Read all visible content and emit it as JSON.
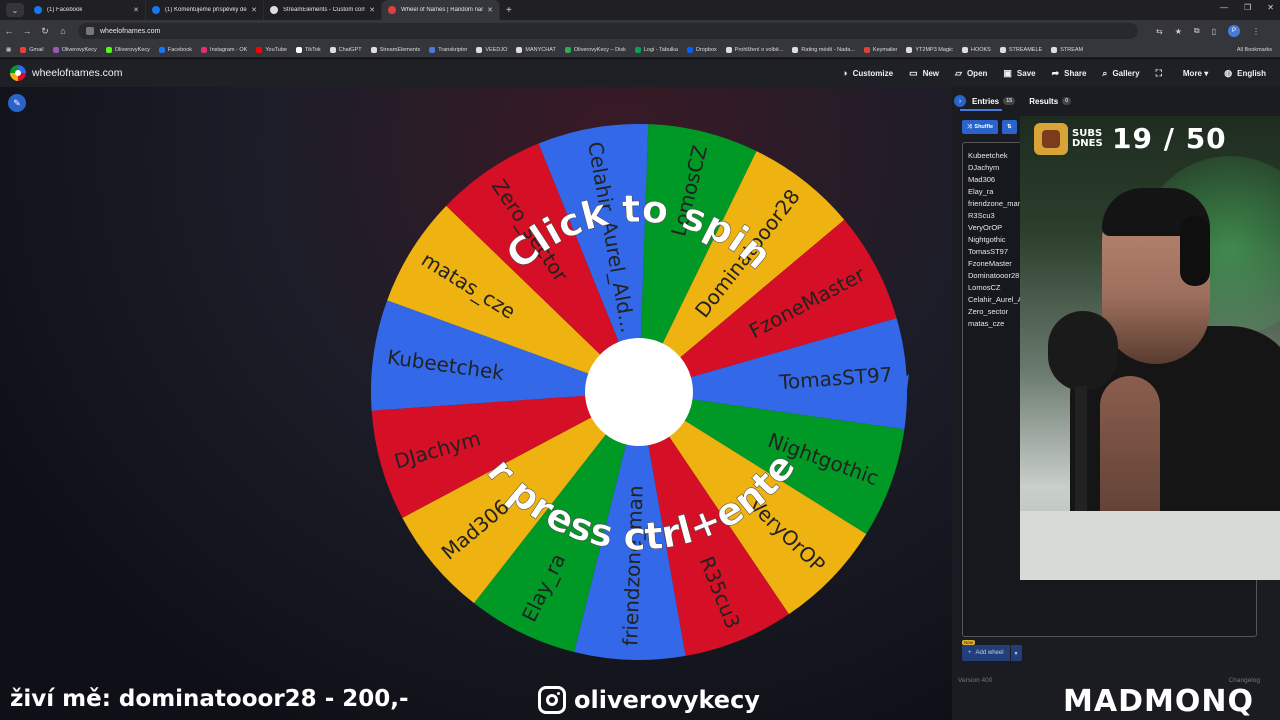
{
  "browser": {
    "tabs": [
      {
        "title": "(1) Facebook",
        "color": "#1877f2",
        "active": false
      },
      {
        "title": "(1) Komentujeme příspěvky de",
        "color": "#1877f2",
        "active": false
      },
      {
        "title": "StreamElements - Custom com",
        "color": "#dddddd",
        "active": false
      },
      {
        "title": "Wheel of Names | Random nam",
        "color": "#e04040",
        "active": true
      }
    ],
    "url": "wheelofnames.com",
    "bookmarks": [
      {
        "label": "Gmail",
        "color": "#ea4335"
      },
      {
        "label": "OliverovyKecy",
        "color": "#9b59b6"
      },
      {
        "label": "OliverovyKecy",
        "color": "#53fc18"
      },
      {
        "label": "Facebook",
        "color": "#1877f2"
      },
      {
        "label": "Instagram - OK",
        "color": "#e1306c"
      },
      {
        "label": "YouTube",
        "color": "#ff0000"
      },
      {
        "label": "TikTok",
        "color": "#ffffff"
      },
      {
        "label": "ChatGPT",
        "color": "#dddddd"
      },
      {
        "label": "StreamElements",
        "color": "#dddddd"
      },
      {
        "label": "Transkriptor",
        "color": "#4a7bd8"
      },
      {
        "label": "VEEDJO",
        "color": "#dddddd"
      },
      {
        "label": "MANYCHAT",
        "color": "#dddddd"
      },
      {
        "label": "OliverovyKecy – Disk",
        "color": "#34a853"
      },
      {
        "label": "Logi - Tabulka",
        "color": "#0f9d58"
      },
      {
        "label": "Dropbox",
        "color": "#0061ff"
      },
      {
        "label": "Prohlížení o volbě...",
        "color": "#dddddd"
      },
      {
        "label": "Rating médií - Nada...",
        "color": "#dddddd"
      },
      {
        "label": "Keymailer",
        "color": "#e04040"
      },
      {
        "label": "YT2MP3 Magic",
        "color": "#dddddd"
      },
      {
        "label": "HOOKS",
        "color": "#dddddd"
      },
      {
        "label": "STREAMELE",
        "color": "#dddddd"
      },
      {
        "label": "STREAM",
        "color": "#dddddd"
      }
    ],
    "all_bookmarks": "All Bookmarks"
  },
  "app": {
    "site_name": "wheelofnames.com",
    "menu": [
      {
        "label": "Customize",
        "icon": "palette-icon",
        "glyph": "◑"
      },
      {
        "label": "New",
        "icon": "new-file-icon",
        "glyph": "▭"
      },
      {
        "label": "Open",
        "icon": "folder-open-icon",
        "glyph": "▱"
      },
      {
        "label": "Save",
        "icon": "save-icon",
        "glyph": "▣"
      },
      {
        "label": "Share",
        "icon": "share-icon",
        "glyph": "➦"
      },
      {
        "label": "Gallery",
        "icon": "search-icon",
        "glyph": "⌕"
      },
      {
        "label": "",
        "icon": "fullscreen-icon",
        "glyph": "⛶"
      },
      {
        "label": "More ▾",
        "icon": "",
        "glyph": ""
      },
      {
        "label": "English",
        "icon": "globe-icon",
        "glyph": "◍"
      }
    ]
  },
  "wheel": {
    "segments": [
      {
        "name": "TomasST97",
        "color": "#3369e8"
      },
      {
        "name": "Nightgothic",
        "color": "#009925"
      },
      {
        "name": "VeryOrOP",
        "color": "#eeb211"
      },
      {
        "name": "R35cu3",
        "color": "#d50f25"
      },
      {
        "name": "friendzone_man",
        "color": "#3369e8"
      },
      {
        "name": "Elay_ra",
        "color": "#009925"
      },
      {
        "name": "Mad306",
        "color": "#eeb211"
      },
      {
        "name": "DJachym",
        "color": "#d50f25"
      },
      {
        "name": "Kubeetchek",
        "color": "#3369e8"
      },
      {
        "name": "matas_cze",
        "color": "#eeb211"
      },
      {
        "name": "Zero_sector",
        "color": "#d50f25"
      },
      {
        "name": "Celahir_Aurel_Ald...",
        "color": "#3369e8"
      },
      {
        "name": "LomosCZ",
        "color": "#009925"
      },
      {
        "name": "Dominatooor28",
        "color": "#eeb211"
      },
      {
        "name": "FzoneMaster",
        "color": "#d50f25"
      }
    ],
    "overlay_top": "Click to spin",
    "overlay_bottom": "or press ctrl+enter",
    "pointer_color": "#3369e8"
  },
  "panel": {
    "tab_entries": "Entries",
    "entries_count": "15",
    "tab_results": "Results",
    "results_count": "0",
    "shuffle_label": "Shuffle",
    "sort_label": "⇅",
    "entries": [
      "Kubeetchek",
      "DJachym",
      "Mad306",
      "Elay_ra",
      "friendzone_man",
      "R3Scu3",
      "VeryOrOP",
      "Nightgothic",
      "TomasST97",
      "FzoneMaster",
      "Dominatooor28",
      "LomosCZ",
      "Celahir_Aurel_Al",
      "Zero_sector",
      "matas_cze"
    ],
    "new_badge": "New",
    "add_wheel": "Add wheel",
    "version": "Version 400",
    "changelog": "Changelog"
  },
  "stream": {
    "subs_label": "SUBS DNES",
    "subs_count": "19 / 50",
    "ticker": "živí mě: dominatooor28 - 200,-",
    "instagram_handle": "oliverovykecy",
    "brand": "MADMONQ"
  }
}
